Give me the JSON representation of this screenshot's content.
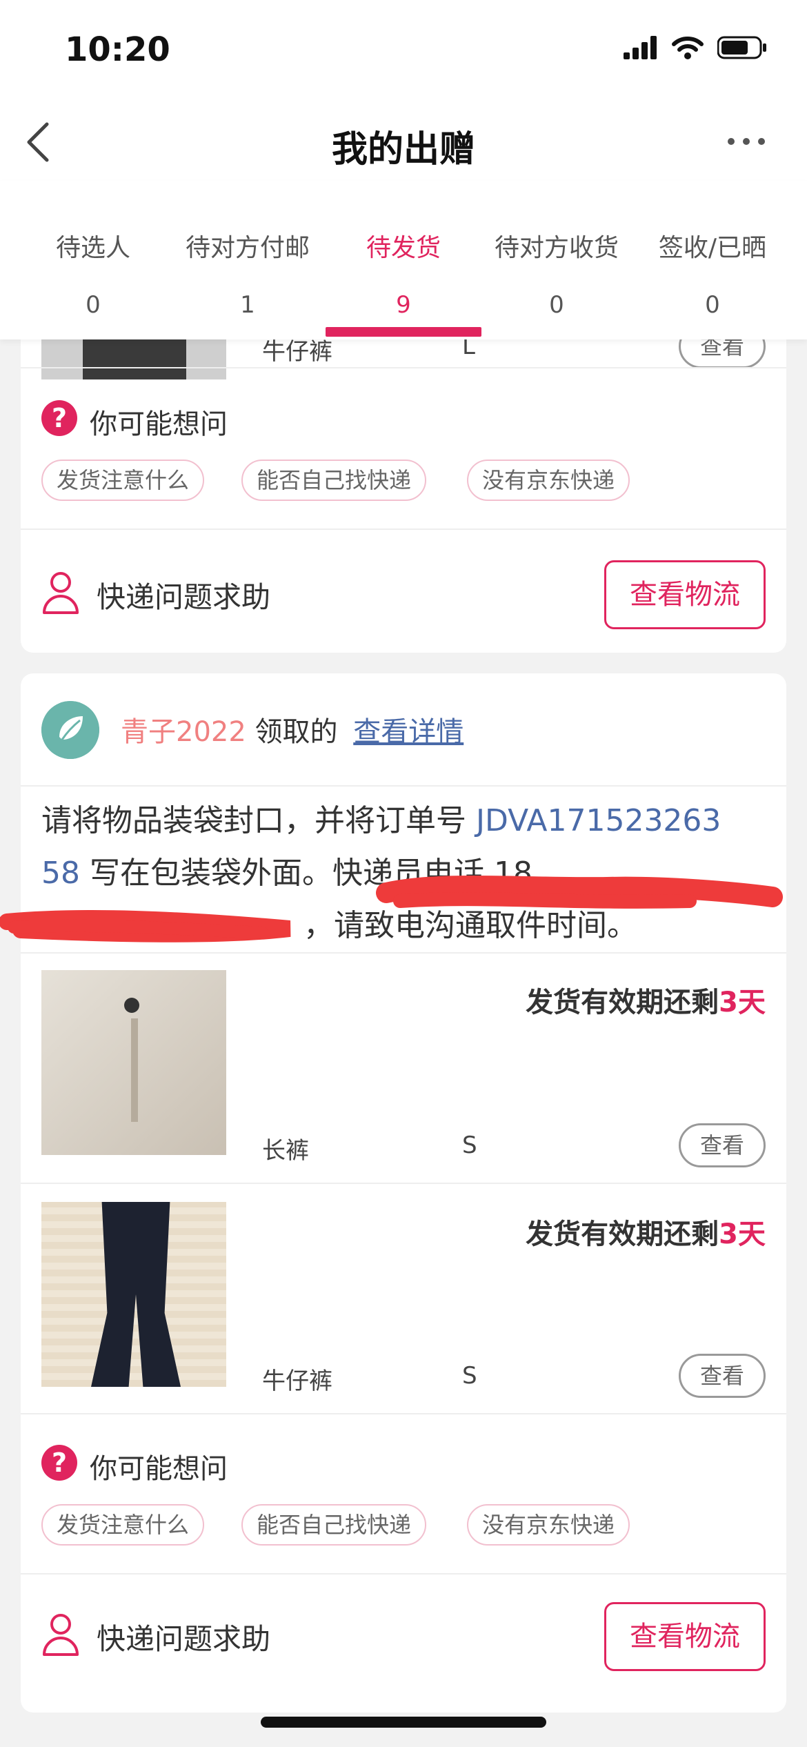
{
  "status_bar": {
    "time": "10:20"
  },
  "nav": {
    "title": "我的出赠"
  },
  "tabs": [
    {
      "label": "待选人",
      "count": "0"
    },
    {
      "label": "待对方付邮",
      "count": "1"
    },
    {
      "label": "待发货",
      "count": "9",
      "active": true
    },
    {
      "label": "待对方收货",
      "count": "0"
    },
    {
      "label": "签收/已晒",
      "count": "0"
    }
  ],
  "card1": {
    "item": {
      "name": "牛仔裤",
      "size": "L",
      "view_label": "查看"
    },
    "faq": {
      "title": "你可能想问",
      "chips": [
        "发货注意什么",
        "能否自己找快递",
        "没有京东快递"
      ]
    },
    "help": {
      "text": "快递问题求助",
      "button": "查看物流"
    }
  },
  "card2": {
    "receiver": {
      "username": "青子2022",
      "action": "领取的",
      "details_link": "查看详情"
    },
    "instruction": {
      "line1_prefix": "请将物品装袋封口，并将订单号 ",
      "order_a": "JDVA171523263",
      "order_b": "58",
      "line2_rest": " 写在包装袋外面。快递员电话 18",
      "line3": "，请致电沟通取件时间。"
    },
    "items": [
      {
        "deadline_prefix": "发货有效期还剩",
        "days": "3天",
        "name": "长裤",
        "size": "S",
        "view_label": "查看"
      },
      {
        "deadline_prefix": "发货有效期还剩",
        "days": "3天",
        "name": "牛仔裤",
        "size": "S",
        "view_label": "查看"
      }
    ],
    "faq": {
      "title": "你可能想问",
      "chips": [
        "发货注意什么",
        "能否自己找快递",
        "没有京东快递"
      ]
    },
    "help": {
      "text": "快递问题求助",
      "button": "查看物流"
    }
  },
  "colors": {
    "accent": "#e0245e",
    "link": "#4a6aa8",
    "username": "#f08080"
  }
}
